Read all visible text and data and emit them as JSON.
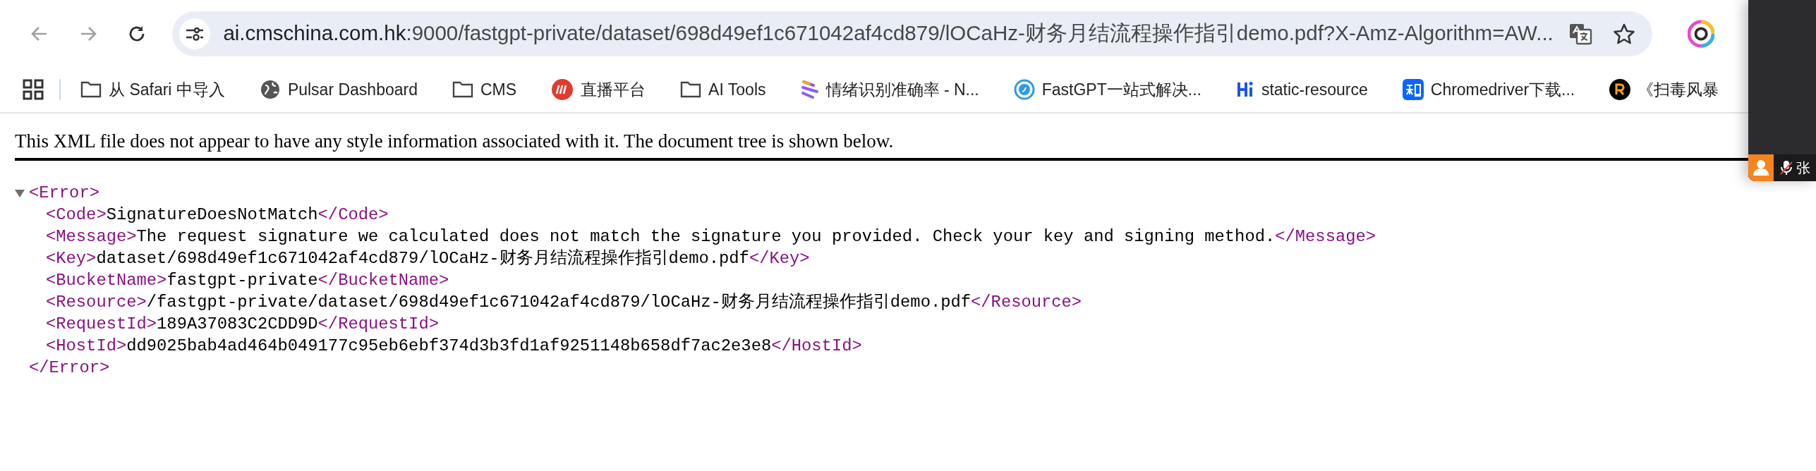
{
  "toolbar": {
    "address": {
      "host": "ai.cmschina.com.hk",
      "rest": ":9000/fastgpt-private/dataset/698d49ef1c671042af4cd879/lOCaHz-财务月结流程操作指引demo.pdf?X-Amz-Algorithm=AW..."
    }
  },
  "bookmarks": [
    {
      "kind": "folder",
      "label": "从 Safari 中导入"
    },
    {
      "kind": "globe",
      "label": "Pulsar Dashboard"
    },
    {
      "kind": "folder",
      "label": "CMS"
    },
    {
      "kind": "live",
      "label": "直播平台"
    },
    {
      "kind": "folder",
      "label": "AI Tools"
    },
    {
      "kind": "stripes",
      "label": "情绪识别准确率 - N..."
    },
    {
      "kind": "ring",
      "label": "FastGPT一站式解决..."
    },
    {
      "kind": "hi",
      "label": "static-resource"
    },
    {
      "kind": "zhi",
      "label": "Chromedriver下载..."
    },
    {
      "kind": "r",
      "label": "《扫毒风暴"
    }
  ],
  "notice": "This XML file does not appear to have any style information associated with it. The document tree is shown below.",
  "xml": {
    "open": "<Error>",
    "close": "</Error>",
    "expanded": true,
    "children": [
      {
        "open": "<Code>",
        "text": "SignatureDoesNotMatch",
        "close": "</Code>"
      },
      {
        "open": "<Message>",
        "text": "The request signature we calculated does not match the signature you provided. Check your key and signing method.",
        "close": "</Message>"
      },
      {
        "open": "<Key>",
        "text": "dataset/698d49ef1c671042af4cd879/lOCaHz-财务月结流程操作指引demo.pdf",
        "close": "</Key>"
      },
      {
        "open": "<BucketName>",
        "text": "fastgpt-private",
        "close": "</BucketName>"
      },
      {
        "open": "<Resource>",
        "text": "/fastgpt-private/dataset/698d49ef1c671042af4cd879/lOCaHz-财务月结流程操作指引demo.pdf",
        "close": "</Resource>"
      },
      {
        "open": "<RequestId>",
        "text": "189A37083C2CDD9D",
        "close": "</RequestId>"
      },
      {
        "open": "<HostId>",
        "text": "dd9025bab4ad464b049177c95eb6ebf374d3b3fd1af9251148b658df7ac2e3e8",
        "close": "</HostId>"
      }
    ]
  },
  "call_widget": {
    "name": "张"
  }
}
